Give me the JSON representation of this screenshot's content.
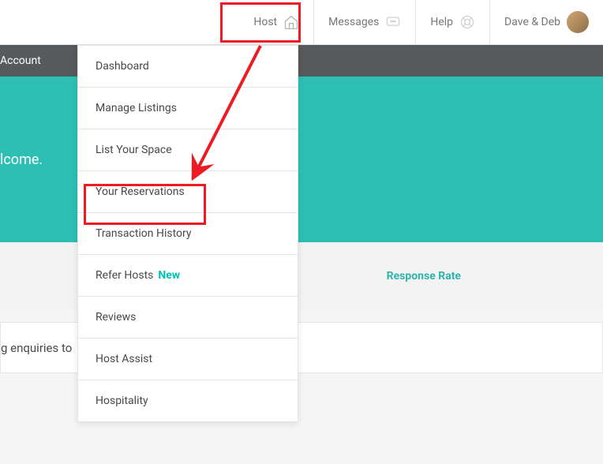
{
  "topnav": {
    "host_label": "Host",
    "messages_label": "Messages",
    "help_label": "Help",
    "user_label": "Dave & Deb"
  },
  "subnav": {
    "account_label": "Account"
  },
  "hero": {
    "welcome_text": "lcome."
  },
  "content": {
    "response_rate_label": "Response Rate",
    "panel_text": "g enquiries to"
  },
  "dropdown": {
    "items": [
      {
        "label": "Dashboard"
      },
      {
        "label": "Manage Listings"
      },
      {
        "label": "List Your Space"
      },
      {
        "label": "Your Reservations"
      },
      {
        "label": "Transaction History"
      },
      {
        "label": "Refer Hosts",
        "badge": "New"
      },
      {
        "label": "Reviews"
      },
      {
        "label": "Host Assist"
      },
      {
        "label": "Hospitality"
      }
    ]
  },
  "colors": {
    "accent": "#2dbfb4",
    "annotation": "#ed1c24"
  }
}
